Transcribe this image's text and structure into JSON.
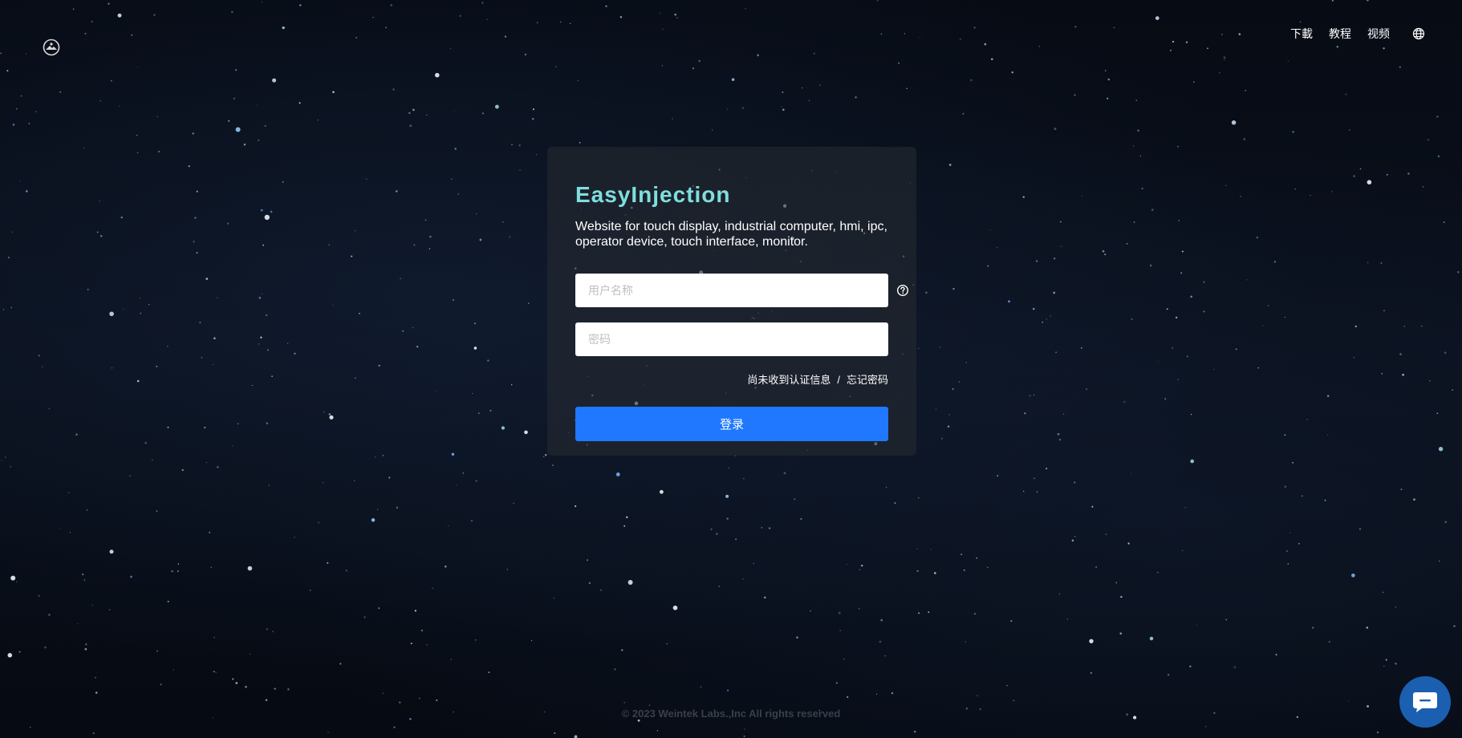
{
  "nav": {
    "download": "下載",
    "tutorial": "教程",
    "video": "视频",
    "language_icon": "globe-icon"
  },
  "logo_icon": "app-logo-icon",
  "login": {
    "brand": "EasyInjection",
    "description": "Website for touch display, industrial computer, hmi, ipc, operator device, touch interface, monitor.",
    "username_placeholder": "用户名称",
    "password_placeholder": "密码",
    "help_icon": "question-circle-icon",
    "resend_link": "尚未收到认证信息",
    "separator": "/",
    "forgot_link": "忘记密码",
    "submit_label": "登录"
  },
  "footer": {
    "copyright": "© 2023 Weintek Labs.,Inc All rights reserved"
  },
  "chat_icon": "chat-bubble-icon",
  "colors": {
    "brand": "#7fdedd",
    "primary": "#1f78ff",
    "chat": "#1b5fb0"
  }
}
